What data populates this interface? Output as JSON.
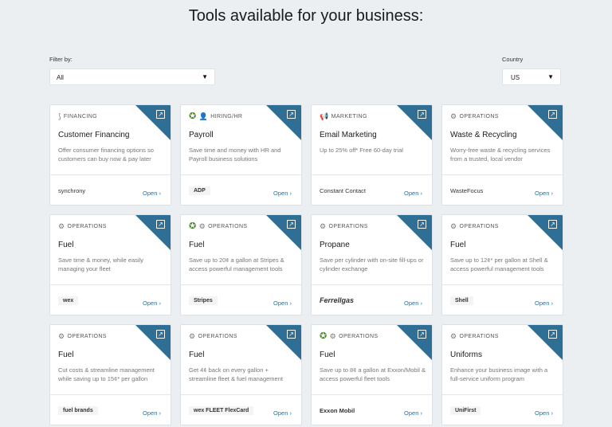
{
  "page": {
    "title": "Tools available for your business:"
  },
  "filter": {
    "label": "Filter by:",
    "value": "All"
  },
  "country": {
    "label": "Country",
    "value": "US"
  },
  "open_label": "Open",
  "cards": [
    {
      "category": "FINANCING",
      "category_icon": "hand-coin-icon",
      "title": "Customer Financing",
      "description": "Offer consumer financing options so customers can buy now & pay later",
      "logo": "synchrony"
    },
    {
      "category": "HIRING/HR",
      "category_icon": "person-add-icon",
      "title": "Payroll",
      "description": "Save time and money with HR and Payroll business solutions",
      "logo": "ADP"
    },
    {
      "category": "MARKETING",
      "category_icon": "megaphone-icon",
      "title": "Email Marketing",
      "description": "Up to 25% off* Free 60-day trial",
      "logo": "Constant Contact"
    },
    {
      "category": "OPERATIONS",
      "category_icon": "gears-icon",
      "title": "Waste & Recycling",
      "description": "Worry-free waste & recycling services from a trusted, local vendor",
      "logo": "WasteFocus"
    },
    {
      "category": "OPERATIONS",
      "category_icon": "gears-icon",
      "title": "Fuel",
      "description": "Save time & money, while easily managing your fleet",
      "logo": "wex"
    },
    {
      "category": "OPERATIONS",
      "category_icon": "gears-icon",
      "title": "Fuel",
      "description": "Save up to 20¢ a gallon at Stripes & access powerful management tools",
      "logo": "Stripes"
    },
    {
      "category": "OPERATIONS",
      "category_icon": "gears-icon",
      "title": "Propane",
      "description": "Save per cylinder with on-site fill-ups or cylinder exchange",
      "logo": "Ferrellgas"
    },
    {
      "category": "OPERATIONS",
      "category_icon": "gears-icon",
      "title": "Fuel",
      "description": "Save up to 12¢* per gallon at Shell & access powerful management tools",
      "logo": "Shell"
    },
    {
      "category": "OPERATIONS",
      "category_icon": "gears-icon",
      "title": "Fuel",
      "description": "Cut costs & streamline management while saving up to 15¢* per gallon",
      "logo": "fuel brands"
    },
    {
      "category": "OPERATIONS",
      "category_icon": "gears-icon",
      "title": "Fuel",
      "description": "Get 4¢ back on every gallon + streamline fleet & fuel management",
      "logo": "wex FLEET FlexCard"
    },
    {
      "category": "OPERATIONS",
      "category_icon": "gears-icon",
      "title": "Fuel",
      "description": "Save up to 8¢ a gallon at Exxon/Mobil & access powerful fleet tools",
      "logo": "Exxon Mobil"
    },
    {
      "category": "OPERATIONS",
      "category_icon": "gears-icon",
      "title": "Uniforms",
      "description": "Enhance your business image with a full-service uniform program",
      "logo": "UniFirst"
    }
  ]
}
